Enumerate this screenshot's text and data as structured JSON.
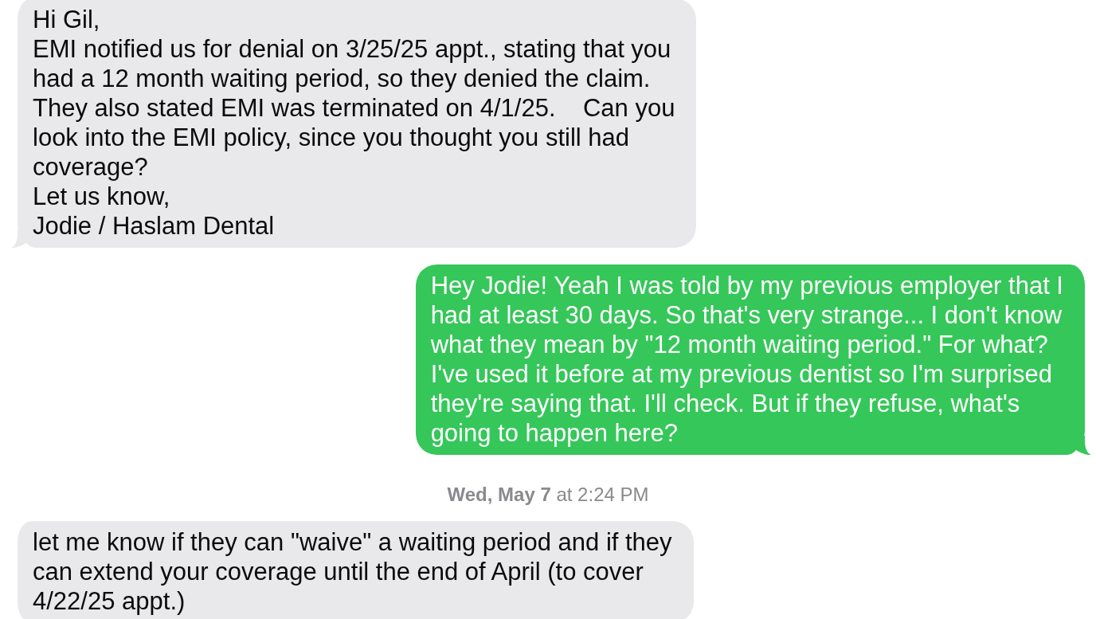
{
  "conversation": [
    {
      "kind": "message",
      "outgoing": false,
      "tail": true,
      "lines": [
        "Hi Gil,",
        "EMI notified us for denial on 3/25/25 appt., stating that you",
        "had a 12 month waiting period, so they denied the claim.",
        "They also stated EMI was terminated on 4/1/25.    Can you",
        "look into the EMI policy, since you thought you still had",
        "coverage?",
        "Let us know,",
        "Jodie / Haslam Dental"
      ]
    },
    {
      "kind": "message",
      "outgoing": true,
      "tail": true,
      "lines": [
        "Hey Jodie! Yeah I was told by my previous employer that I",
        "had at least 30 days. So that's very strange... I don't know",
        "what they mean by \"12 month waiting period.\" For what?",
        "I've used it before at my previous dentist so I'm surprised",
        "they're saying that. I'll check. But if they refuse, what's",
        "going to happen here?"
      ]
    },
    {
      "kind": "timestamp",
      "text": "**Wed, May 7** at 2:24 PM"
    },
    {
      "kind": "message",
      "outgoing": false,
      "tail": false,
      "lines": [
        "let me know if they can \"waive\" a waiting period and if they",
        "can extend your coverage until the end of April (to cover",
        "4/22/25 appt.)"
      ]
    }
  ]
}
